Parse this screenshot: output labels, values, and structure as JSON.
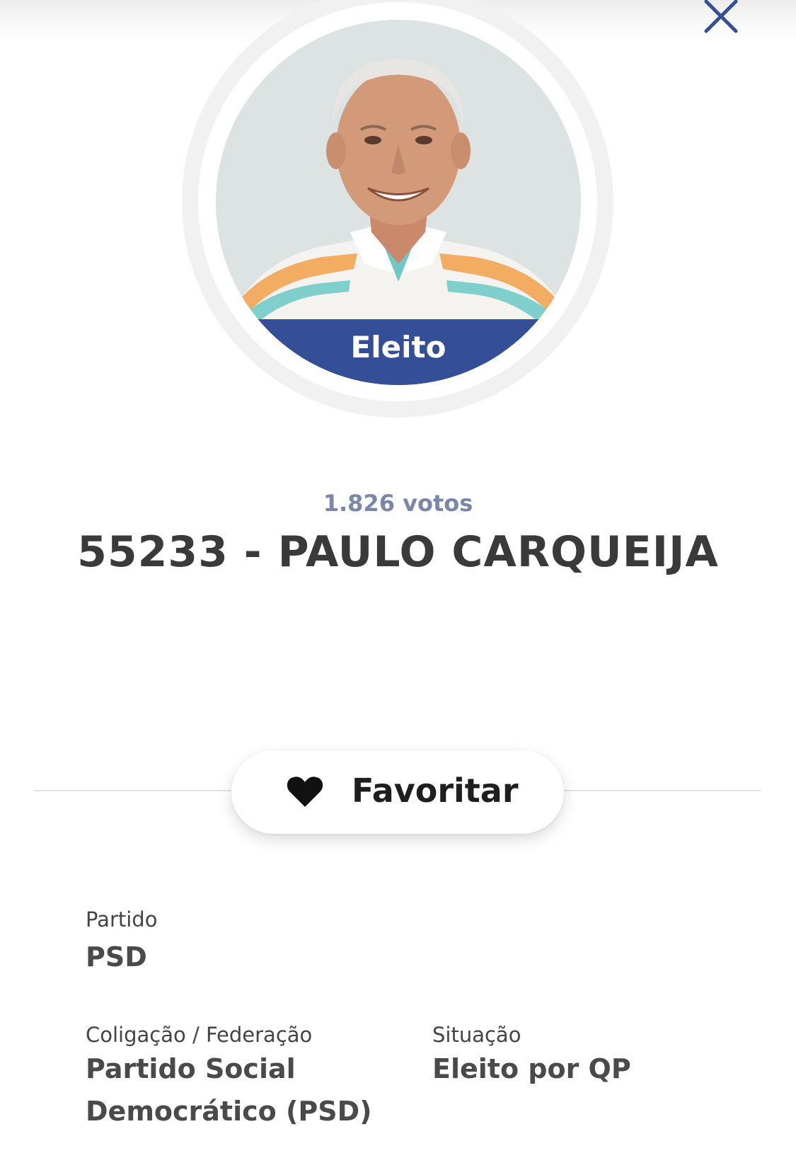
{
  "header": {
    "close_icon": "close-icon"
  },
  "candidate": {
    "status_badge": "Eleito",
    "votes": "1.826 votos",
    "title": "55233 - PAULO CARQUEIJA"
  },
  "actions": {
    "favorite_label": "Favoritar",
    "favorite_icon": "heart-icon"
  },
  "details": {
    "party_label": "Partido",
    "party_value": "PSD",
    "coalition_label": "Coligação / Federação",
    "coalition_value_line1": "Partido Social",
    "coalition_value_line2": "Democrático (PSD)",
    "situation_label": "Situação",
    "situation_value": "Eleito por QP"
  },
  "colors": {
    "accent": "#344f98",
    "votes_text": "#7a87a8",
    "title_text": "#3a3a3a"
  }
}
